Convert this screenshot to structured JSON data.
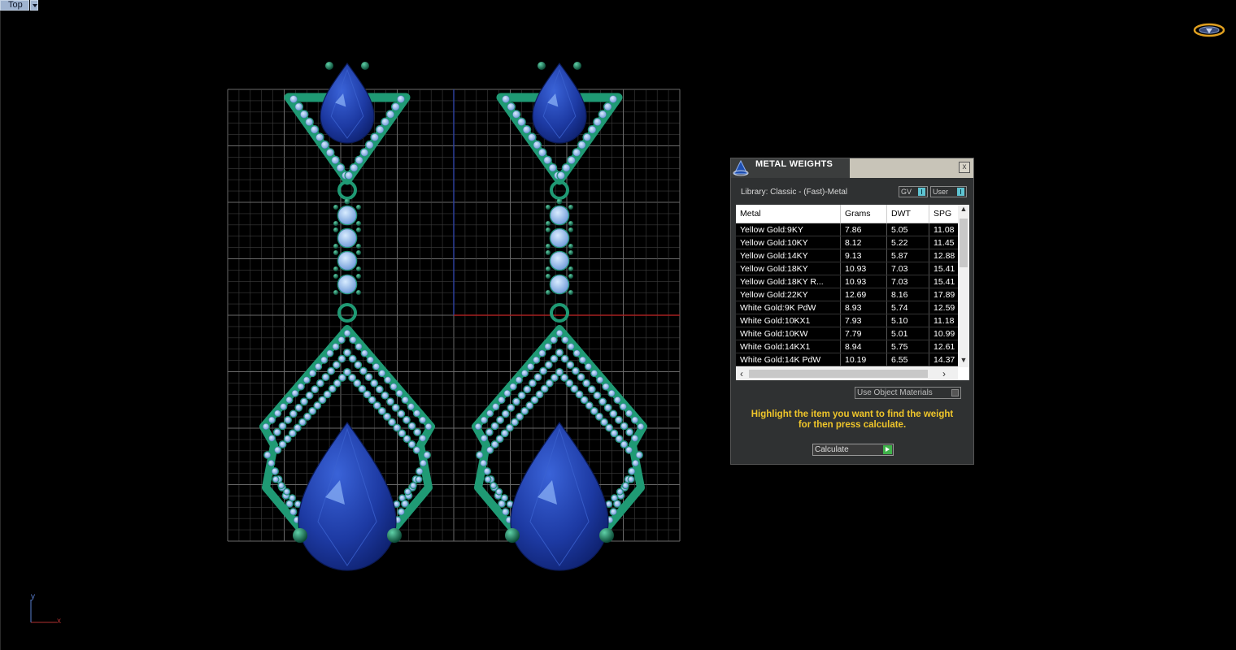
{
  "viewport": {
    "name": "Top",
    "axis_x": "x",
    "axis_y": "y"
  },
  "panel": {
    "title": "METAL WEIGHTS",
    "close": "x",
    "library_label": "Library: Classic - (Fast)-Metal",
    "toggle_gv": "GV",
    "toggle_user": "User",
    "columns": [
      "Metal",
      "Grams",
      "DWT",
      "SPG"
    ],
    "rows": [
      [
        "Yellow Gold:9KY",
        "7.86",
        "5.05",
        "11.08"
      ],
      [
        "Yellow Gold:10KY",
        "8.12",
        "5.22",
        "11.45"
      ],
      [
        "Yellow Gold:14KY",
        "9.13",
        "5.87",
        "12.88"
      ],
      [
        "Yellow Gold:18KY",
        "10.93",
        "7.03",
        "15.41"
      ],
      [
        "Yellow Gold:18KY R...",
        "10.93",
        "7.03",
        "15.41"
      ],
      [
        "Yellow Gold:22KY",
        "12.69",
        "8.16",
        "17.89"
      ],
      [
        "White Gold:9K PdW",
        "8.93",
        "5.74",
        "12.59"
      ],
      [
        "White Gold:10KX1",
        "7.93",
        "5.10",
        "11.18"
      ],
      [
        "White Gold:10KW",
        "7.79",
        "5.01",
        "10.99"
      ],
      [
        "White Gold:14KX1",
        "8.94",
        "5.75",
        "12.61"
      ],
      [
        "White Gold:14K PdW",
        "10.19",
        "6.55",
        "14.37"
      ]
    ],
    "use_object_materials": "Use Object Materials",
    "hint_line1": "Highlight the item you want to find the weight",
    "hint_line2": "for then press calculate.",
    "calculate": "Calculate"
  },
  "colors": {
    "background": "#000000",
    "gem_blue": "#1f3fae",
    "setting_green": "#1f9a74",
    "diamond": "#9ec4f2",
    "hint_text": "#f0c62a"
  }
}
